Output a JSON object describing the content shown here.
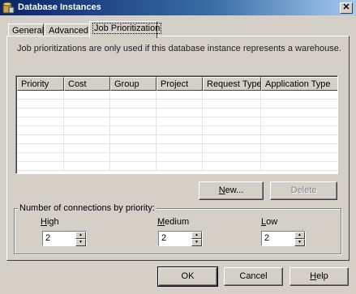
{
  "window": {
    "title": "Database Instances",
    "close_glyph": "✕",
    "icon": "database-icon"
  },
  "tabs": [
    {
      "label": "General",
      "active": false
    },
    {
      "label": "Advanced",
      "active": false
    },
    {
      "label": "Job Prioritization",
      "active": true
    }
  ],
  "job_tab": {
    "description": "Job prioritizations are only used if this database instance represents a warehouse.",
    "columns": [
      "Priority",
      "Cost",
      "Group",
      "Project",
      "Request Type",
      "Application Type"
    ],
    "rows": [],
    "new_button": {
      "prefix": "",
      "accel": "N",
      "rest": "ew..."
    },
    "delete_button": {
      "label": "Delete",
      "enabled": false
    }
  },
  "connections": {
    "group_label": "Number of connections by priority:",
    "high": {
      "accel": "H",
      "rest": "igh",
      "value": "2"
    },
    "medium": {
      "accel": "M",
      "rest": "edium",
      "value": "2"
    },
    "low": {
      "accel": "L",
      "rest": "ow",
      "value": "2"
    }
  },
  "footer": {
    "ok_label": "OK",
    "cancel_label": "Cancel",
    "help": {
      "accel": "H",
      "rest": "elp"
    }
  }
}
